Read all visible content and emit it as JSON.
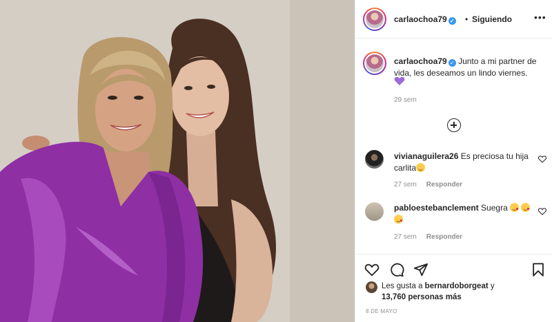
{
  "header": {
    "username": "carlaochoa79",
    "verified": true,
    "separator": "•",
    "follow_status": "Siguiendo",
    "more_icon": "more-options-icon"
  },
  "caption": {
    "username": "carlaochoa79",
    "text": "Junto a mi partner de vida, les deseamos un lindo viernes.",
    "emoji": "purple-heart",
    "time": "29 sem"
  },
  "load_more_icon": "plus-circle-icon",
  "comments": [
    {
      "username": "vivianaguilera26",
      "text": "Es preciosa tu hija carlita",
      "emoji": "smiling-face",
      "time": "27 sem",
      "reply_label": "Responder"
    },
    {
      "username": "pabloestebanclement",
      "text": "Suegra",
      "emojis": [
        "kissing-face",
        "kissing-face",
        "kissing-face"
      ],
      "time": "27 sem",
      "reply_label": "Responder"
    }
  ],
  "actions": {
    "like_icon": "heart-icon",
    "comment_icon": "comment-icon",
    "share_icon": "paper-plane-icon",
    "save_icon": "bookmark-icon"
  },
  "likes": {
    "prefix": "Les gusta a",
    "first_user": "bernardoborgeat",
    "conjunction": "y",
    "count": "13,760",
    "suffix": "personas más"
  },
  "post_date": "8 DE MAYO",
  "colors": {
    "blouse": "#8e2fa4",
    "verified": "#3897f0",
    "secondary_text": "#8e8e8e",
    "heart_purple": "#9b6bd8"
  }
}
